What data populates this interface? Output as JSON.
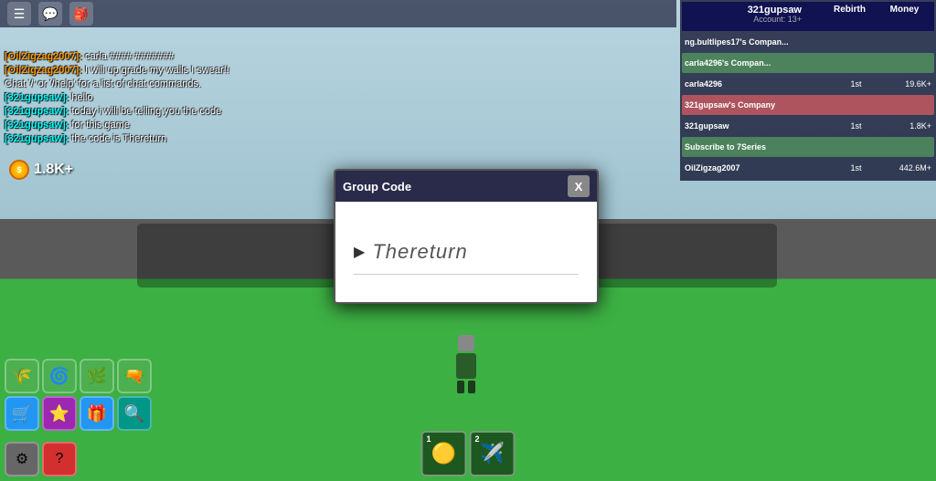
{
  "background": {
    "sky_color": "#b8d4e0",
    "ground_color": "#3cb043",
    "road_color": "#777"
  },
  "topbar": {
    "menu_icon": "☰",
    "chat_icon": "💬",
    "bag_icon": "🎒"
  },
  "chat": {
    "lines": [
      {
        "username": "[OilZigzag2007]:",
        "username_color": "orange",
        "message": "carla #### #######"
      },
      {
        "username": "[OilZigzag2007]:",
        "username_color": "orange",
        "message": "I will up grade my walls I swear!!"
      },
      {
        "username": "",
        "username_color": "",
        "message": "Chat '/' or '/help' for a list of chat commands."
      },
      {
        "username": "[321gupsaw]:",
        "username_color": "cyan",
        "message": "hello"
      },
      {
        "username": "[321gupsaw]:",
        "username_color": "cyan",
        "message": "today i will be telling you the code"
      },
      {
        "username": "[321gupsaw]:",
        "username_color": "cyan",
        "message": "for this game"
      },
      {
        "username": "[321gupsaw]:",
        "username_color": "cyan",
        "message": "the code is Thereturn"
      }
    ]
  },
  "money": {
    "amount": "1.8K+",
    "coin_label": "$"
  },
  "toolbar": {
    "buttons": [
      {
        "icon": "🌾",
        "color": "green-bg",
        "label": "wheat"
      },
      {
        "icon": "🌀",
        "color": "green-bg",
        "label": "wind"
      },
      {
        "icon": "🌿",
        "color": "green-bg",
        "label": "plant"
      },
      {
        "icon": "🔧",
        "color": "green-bg",
        "label": "tool"
      },
      {
        "icon": "🛒",
        "color": "blue-bg",
        "label": "cart"
      },
      {
        "icon": "⭐",
        "color": "purple-bg",
        "label": "star"
      },
      {
        "icon": "🎁",
        "color": "blue-bg",
        "label": "gift"
      },
      {
        "icon": "🔍",
        "color": "teal-bg",
        "label": "search"
      }
    ]
  },
  "bottom_left": {
    "settings_icon": "⚙",
    "help_icon": "?"
  },
  "leaderboard": {
    "player_name": "321gupsaw",
    "account_level": "Account: 13+",
    "headers": [
      "Rebirth",
      "Money"
    ],
    "player_stats": {
      "rebirth": "1st",
      "money": "1.8K+"
    },
    "rows": [
      {
        "name": "ng.bultlipes17's Compan...",
        "rebirth": "",
        "money": "",
        "highlight": "none"
      },
      {
        "name": "carla4296's Compan...",
        "rebirth": "",
        "money": "",
        "highlight": "green"
      },
      {
        "name": "carla4296",
        "rebirth": "1st",
        "money": "19.6K+",
        "highlight": "none"
      },
      {
        "name": "321gupsaw's Company",
        "rebirth": "",
        "money": "",
        "highlight": "red"
      },
      {
        "name": "321gupsaw",
        "rebirth": "1st",
        "money": "1.8K+",
        "highlight": "none"
      },
      {
        "name": "Subscribe to 7Series",
        "rebirth": "",
        "money": "",
        "highlight": "green"
      },
      {
        "name": "OilZigzag2007",
        "rebirth": "1st",
        "money": "442.6M+",
        "highlight": "none"
      }
    ]
  },
  "modal": {
    "title": "Group Code",
    "close_label": "X",
    "code_value": "Thereturn",
    "cursor": "▶"
  },
  "item_bar": {
    "slots": [
      {
        "num": "1",
        "icon": "🟡",
        "type": "coin-item"
      },
      {
        "num": "2",
        "icon": "✈",
        "type": "plane-item"
      }
    ]
  }
}
